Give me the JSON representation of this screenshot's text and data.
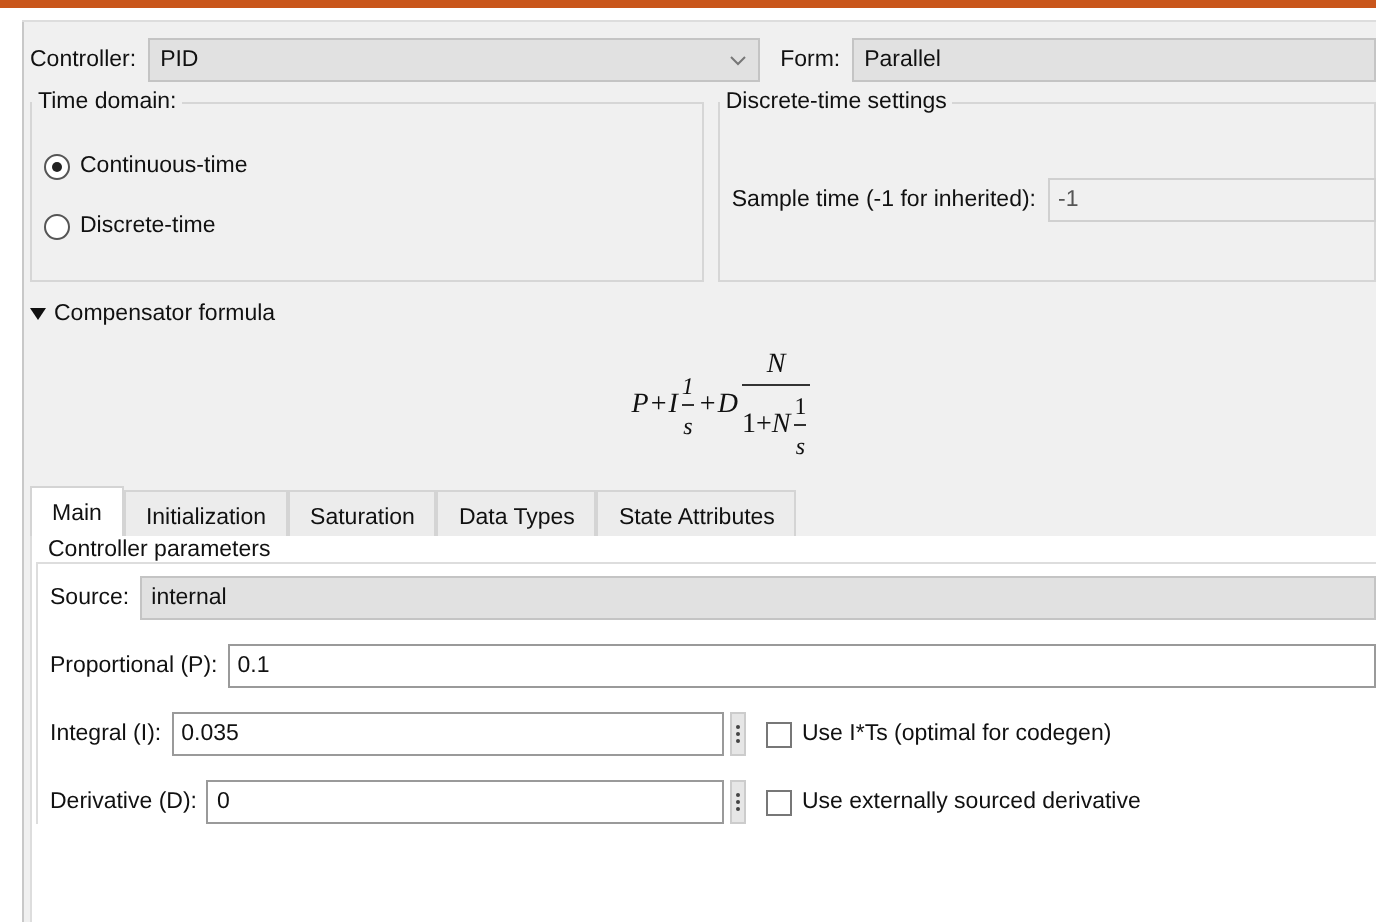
{
  "controller": {
    "label": "Controller:",
    "value": "PID"
  },
  "form": {
    "label": "Form:",
    "value": "Parallel"
  },
  "time_domain": {
    "title": "Time domain:",
    "options": [
      {
        "label": "Continuous-time",
        "selected": true
      },
      {
        "label": "Discrete-time",
        "selected": false
      }
    ]
  },
  "discrete_settings": {
    "title": "Discrete-time settings",
    "label": "Sample time (-1 for inherited):",
    "value": "-1",
    "disabled": true
  },
  "compensator": {
    "title": "Compensator formula",
    "expanded": true,
    "formula": [
      {
        "kind": "sym",
        "text": "P"
      },
      {
        "kind": "op",
        "text": "+"
      },
      {
        "kind": "sym",
        "text": "I"
      },
      {
        "kind": "frac",
        "num": [
          {
            "kind": "sym",
            "text": "1"
          }
        ],
        "den": [
          {
            "kind": "sym",
            "text": "s"
          }
        ]
      },
      {
        "kind": "op",
        "text": "+"
      },
      {
        "kind": "sym",
        "text": "D"
      },
      {
        "kind": "bigfrac",
        "num": [
          {
            "kind": "sym",
            "text": "N"
          }
        ],
        "den": [
          {
            "kind": "rich",
            "text": "1+*N*"
          },
          {
            "kind": "frac",
            "num": [
              {
                "kind": "num",
                "text": "1"
              }
            ],
            "den": [
              {
                "kind": "sym",
                "text": "s"
              }
            ]
          }
        ]
      }
    ]
  },
  "tabs": [
    {
      "label": "Main",
      "selected": true
    },
    {
      "label": "Initialization",
      "selected": false
    },
    {
      "label": "Saturation",
      "selected": false
    },
    {
      "label": "Data Types",
      "selected": false
    },
    {
      "label": "State Attributes",
      "selected": false
    }
  ],
  "controller_parameters": {
    "title": "Controller parameters",
    "rows": [
      {
        "kind": "dropdown",
        "label": "Source:",
        "value": "internal"
      },
      {
        "kind": "field",
        "label": "Proportional (P):",
        "value": "0.1"
      },
      {
        "kind": "field_check",
        "label": "Integral (I):",
        "value": "0.035",
        "checkbox": {
          "label": "Use I*Ts (optimal for codegen)",
          "checked": false
        }
      },
      {
        "kind": "field_check",
        "label": "Derivative (D):",
        "value": "0",
        "checkbox": {
          "label": "Use externally sourced derivative",
          "checked": false
        }
      }
    ]
  }
}
